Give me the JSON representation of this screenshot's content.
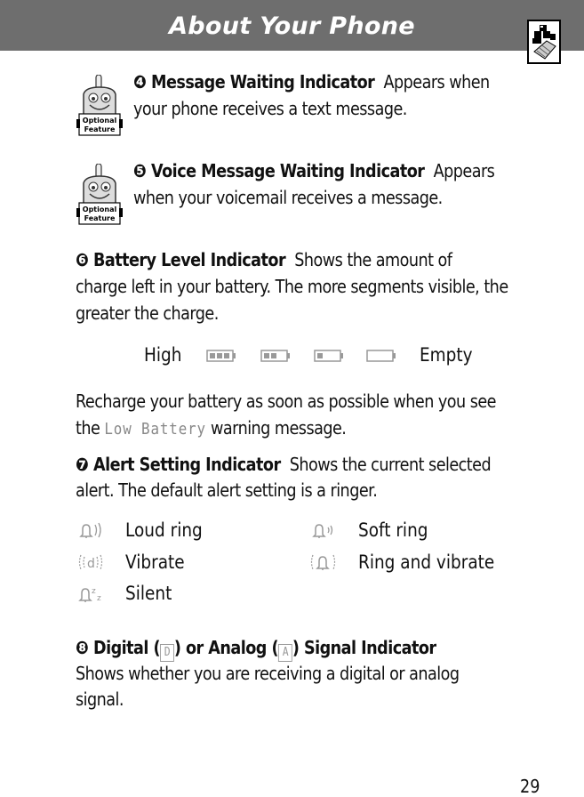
{
  "header": {
    "title": "About Your Phone",
    "corner_icon": "phone-with-blocks-icon"
  },
  "sections": {
    "message_waiting": {
      "number": "❹",
      "title": "Message Waiting Indicator",
      "body_line1": "Appears when",
      "body_line2": "your phone receives a text message.",
      "badge": "Optional Feature"
    },
    "voice_message": {
      "number": "❺",
      "title": "Voice Message Waiting Indicator",
      "body_line1": "Appears",
      "body_line2": "when your voicemail receives a message.",
      "badge": "Optional Feature"
    },
    "battery": {
      "number": "❻",
      "title": "Battery Level Indicator",
      "body_line1": "Shows the amount of",
      "body_line2": "charge left in your battery. The more segments visible, the",
      "body_line3": "greater the charge.",
      "scale_high": "High",
      "scale_empty": "Empty",
      "levels": [
        3,
        2,
        1,
        0
      ],
      "recharge_line1": "Recharge your battery as soon as possible when you see",
      "recharge_prefix": "the",
      "warning_message": "Low Battery",
      "recharge_suffix": "warning message."
    },
    "alert": {
      "number": "❼",
      "title": "Alert Setting Indicator",
      "body_line1": "Shows the current selected",
      "body_line2": "alert. The default alert setting is a ringer.",
      "items": [
        {
          "icon": "loud-ring-icon",
          "label": "Loud ring"
        },
        {
          "icon": "soft-ring-icon",
          "label": "Soft ring"
        },
        {
          "icon": "vibrate-icon",
          "label": "Vibrate"
        },
        {
          "icon": "ring-and-vibrate-icon",
          "label": "Ring and vibrate"
        },
        {
          "icon": "silent-icon",
          "label": "Silent"
        }
      ]
    },
    "signal": {
      "number": "❽",
      "title_part1": "Digital (",
      "digital_glyph": "D",
      "title_part2": ") or Analog (",
      "analog_glyph": "A",
      "title_part3": ") Signal Indicator",
      "body_line1": "Shows whether you are receiving a digital or analog",
      "body_line2": "signal."
    }
  },
  "footer": {
    "page_number": "29"
  },
  "colors": {
    "header_bg": "#6e6e6e",
    "icon_gray": "#999999"
  }
}
